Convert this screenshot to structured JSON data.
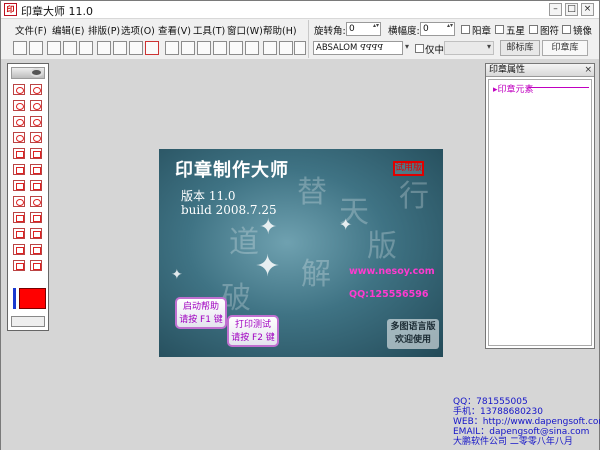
{
  "window": {
    "icon_text": "印",
    "title": "印章大师 11.0",
    "controls": {
      "minimize": "–",
      "maximize": "□",
      "close": "×"
    }
  },
  "menu": [
    "文件(F)",
    "编辑(E)",
    "排版(P)",
    "选项(O)",
    "查看(V)",
    "工具(T)",
    "窗口(W)",
    "帮助(H)"
  ],
  "toolbar_icons": [
    "new-file-icon",
    "open-folder-icon",
    "save-icon",
    "print-preview-icon",
    "print-icon",
    "cut-icon",
    "copy-icon",
    "paste-icon",
    "delete-icon",
    "align-left-icon",
    "align-center-icon",
    "align-right-icon",
    "align-top-icon",
    "align-middle-icon",
    "align-bottom-icon",
    "export-icon",
    "picture-icon",
    "help-icon"
  ],
  "props_bar": {
    "rotate_label": "旋转角:",
    "rotate_value": "0",
    "width_label": "横幅度:",
    "width_value": "0",
    "checkboxes": [
      "阳章",
      "五星",
      "图符",
      "镜像"
    ],
    "font_value": "ABSALOM",
    "font_sample": "ꟼꟼꟼꟼ",
    "chinese_only_label": "仅中文",
    "tabs": [
      "邮标库",
      "印章库"
    ]
  },
  "properties_panel": {
    "title": "印章属性",
    "close": "×",
    "group": "▸印章元素"
  },
  "splash": {
    "title": "印章制作大师",
    "badge": "试用版",
    "version": "版本 11.0",
    "build": "build 2008.7.25",
    "website": "www.nesoy.com",
    "qq": "QQ:125556596",
    "button_help": [
      "启动帮助",
      "请按 F1 键"
    ],
    "button_print": [
      "打印测试",
      "请按 F2 键"
    ],
    "slogan": [
      "多图语言版",
      "欢迎使用"
    ],
    "calligraphy": [
      "替",
      "天",
      "行",
      "道",
      "破",
      "解",
      "版"
    ]
  },
  "contact": {
    "qq": "QQ：781555005",
    "phone": "手机：13788680230",
    "web": "WEB：http://www.dapengsoft.com.cn",
    "email": "EMAIL：dapengsoft@sina.com",
    "company": "大鹏软件公司   二零零八年八月"
  },
  "colors": {
    "current_color": "#ff0000",
    "accent": "#1515c8",
    "magenta": "#ff3ad0"
  }
}
